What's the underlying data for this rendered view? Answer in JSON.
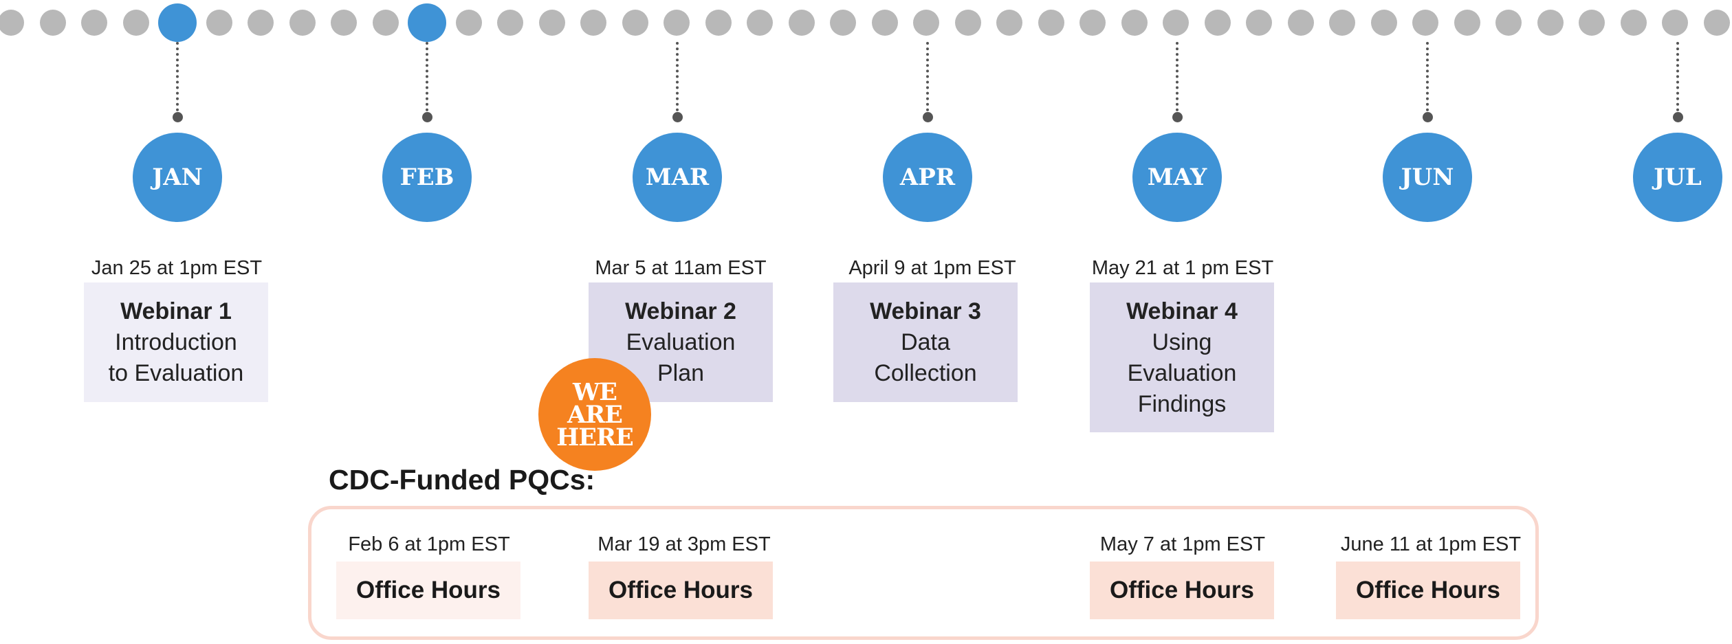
{
  "months": [
    "JAN",
    "FEB",
    "MAR",
    "APR",
    "MAY",
    "JUN",
    "JUL"
  ],
  "webinars": [
    {
      "date": "Jan 25 at 1pm EST",
      "title": "Webinar 1",
      "subtitle": [
        "Introduction",
        "to Evaluation"
      ]
    },
    {
      "date": "Mar 5 at 11am EST",
      "title": "Webinar 2",
      "subtitle": [
        "Evaluation",
        "Plan"
      ]
    },
    {
      "date": "April 9 at 1pm EST",
      "title": "Webinar 3",
      "subtitle": [
        "Data",
        "Collection"
      ]
    },
    {
      "date": "May 21 at 1 pm EST",
      "title": "Webinar 4",
      "subtitle": [
        "Using",
        "Evaluation",
        "Findings"
      ]
    }
  ],
  "badge": {
    "lines": [
      "WE",
      "ARE",
      "HERE"
    ]
  },
  "office_hours": {
    "heading": "CDC-Funded PQCs:",
    "sessions": [
      {
        "date": "Feb 6 at 1pm EST",
        "label": "Office Hours"
      },
      {
        "date": "Mar 19 at 3pm EST",
        "label": "Office Hours"
      },
      {
        "date": "May 7 at 1pm EST",
        "label": "Office Hours"
      },
      {
        "date": "June 11 at 1pm EST",
        "label": "Office Hours"
      }
    ]
  },
  "colors": {
    "month_blue": "#3f93d6",
    "dot_gray": "#b8b8b8",
    "badge_orange": "#f58220",
    "card_lavender": "#dddaeb",
    "office_hours_peach": "#fbe0d6"
  }
}
